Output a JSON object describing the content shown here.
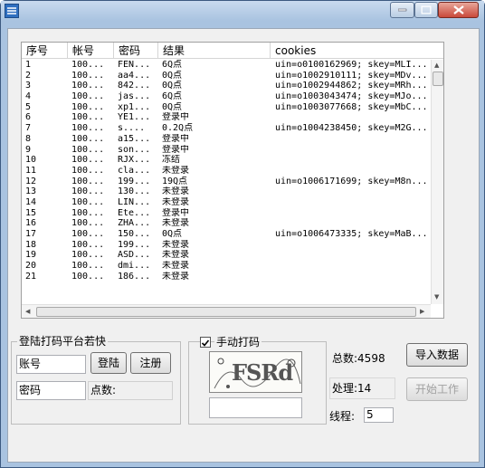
{
  "list": {
    "columns": [
      "序号",
      "帐号",
      "密码",
      "结果",
      "cookies"
    ],
    "rows": [
      [
        "1",
        "100...",
        "FEN...",
        "6Q点",
        "uin=o0100162969; skey=MLI..."
      ],
      [
        "2",
        "100...",
        "aa4...",
        "0Q点",
        "uin=o1002910111; skey=MDv..."
      ],
      [
        "3",
        "100...",
        "842...",
        "0Q点",
        "uin=o1002944862; skey=MRh..."
      ],
      [
        "4",
        "100...",
        "jas...",
        "6Q点",
        "uin=o1003043474; skey=MJo..."
      ],
      [
        "5",
        "100...",
        "xp1...",
        "0Q点",
        "uin=o1003077668; skey=MbC..."
      ],
      [
        "6",
        "100...",
        "YE1...",
        "登录中",
        ""
      ],
      [
        "7",
        "100...",
        "s....",
        "0.2Q点",
        "uin=o1004238450; skey=M2G..."
      ],
      [
        "8",
        "100...",
        "a15...",
        "登录中",
        ""
      ],
      [
        "9",
        "100...",
        "son...",
        "登录中",
        ""
      ],
      [
        "10",
        "100...",
        "RJX...",
        "冻结",
        ""
      ],
      [
        "11",
        "100...",
        "cla...",
        "未登录",
        ""
      ],
      [
        "12",
        "100...",
        "199...",
        "19Q点",
        "uin=o1006171699; skey=M8n..."
      ],
      [
        "13",
        "100...",
        "130...",
        "未登录",
        ""
      ],
      [
        "14",
        "100...",
        "LIN...",
        "未登录",
        ""
      ],
      [
        "15",
        "100...",
        "Ete...",
        "登录中",
        ""
      ],
      [
        "16",
        "100...",
        "ZHA...",
        "未登录",
        ""
      ],
      [
        "17",
        "100...",
        "150...",
        "0Q点",
        "uin=o1006473335; skey=MaB..."
      ],
      [
        "18",
        "100...",
        "199...",
        "未登录",
        ""
      ],
      [
        "19",
        "100...",
        "ASD...",
        "未登录",
        ""
      ],
      [
        "20",
        "100...",
        "dmi...",
        "未登录",
        ""
      ],
      [
        "21",
        "100...",
        "186...",
        "未登录",
        ""
      ]
    ]
  },
  "login": {
    "group_title": "登陆打码平台若快",
    "account_label": "账号",
    "password_label": "密码",
    "account_value": "",
    "password_value": "",
    "login_button": "登陆",
    "register_button": "注册",
    "points_label": "点数:"
  },
  "captcha": {
    "manual_label": "手动打码",
    "manual_checked": true,
    "image_text": "FSRd",
    "input_value": ""
  },
  "stats": {
    "total": "总数:4598",
    "processed": "处理:14",
    "threads_label": "线程:",
    "threads_value": "5",
    "import_button": "导入数据",
    "start_button": "开始工作"
  }
}
